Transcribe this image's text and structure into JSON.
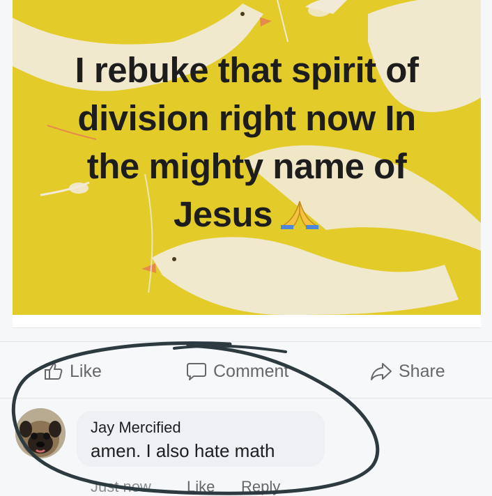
{
  "post": {
    "lines": [
      "I rebuke that spirit of",
      "division right now In",
      "the mighty name of",
      "Jesus"
    ],
    "emoji": "praying-hands-emoji",
    "background_color": "#e3cc2a"
  },
  "actions": {
    "like": "Like",
    "comment": "Comment",
    "share": "Share"
  },
  "comment": {
    "author": "Jay Mercified",
    "text": "amen. I also hate math",
    "timestamp": "Just now",
    "like": "Like",
    "reply": "Reply"
  },
  "colors": {
    "dove": "#f1ead7",
    "action_text": "#65676b",
    "circle_ink": "#2d3a40"
  }
}
